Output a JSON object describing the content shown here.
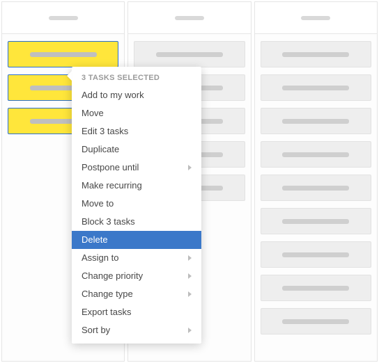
{
  "columns": [
    {
      "cards": 3,
      "selected": true
    },
    {
      "cards": 5,
      "selected": false
    },
    {
      "cards": 9,
      "selected": false
    }
  ],
  "menu": {
    "header": "3 TASKS SELECTED",
    "items": [
      {
        "label": "Add to my work",
        "submenu": false,
        "highlight": false
      },
      {
        "label": "Move",
        "submenu": false,
        "highlight": false
      },
      {
        "label": "Edit 3 tasks",
        "submenu": false,
        "highlight": false
      },
      {
        "label": "Duplicate",
        "submenu": false,
        "highlight": false
      },
      {
        "label": "Postpone until",
        "submenu": true,
        "highlight": false
      },
      {
        "label": "Make recurring",
        "submenu": false,
        "highlight": false
      },
      {
        "label": "Move to",
        "submenu": false,
        "highlight": false
      },
      {
        "label": "Block 3 tasks",
        "submenu": false,
        "highlight": false
      },
      {
        "label": "Delete",
        "submenu": false,
        "highlight": true
      },
      {
        "label": "Assign to",
        "submenu": true,
        "highlight": false
      },
      {
        "label": "Change priority",
        "submenu": true,
        "highlight": false
      },
      {
        "label": "Change type",
        "submenu": true,
        "highlight": false
      },
      {
        "label": "Export tasks",
        "submenu": false,
        "highlight": false
      },
      {
        "label": "Sort by",
        "submenu": true,
        "highlight": false
      }
    ]
  }
}
